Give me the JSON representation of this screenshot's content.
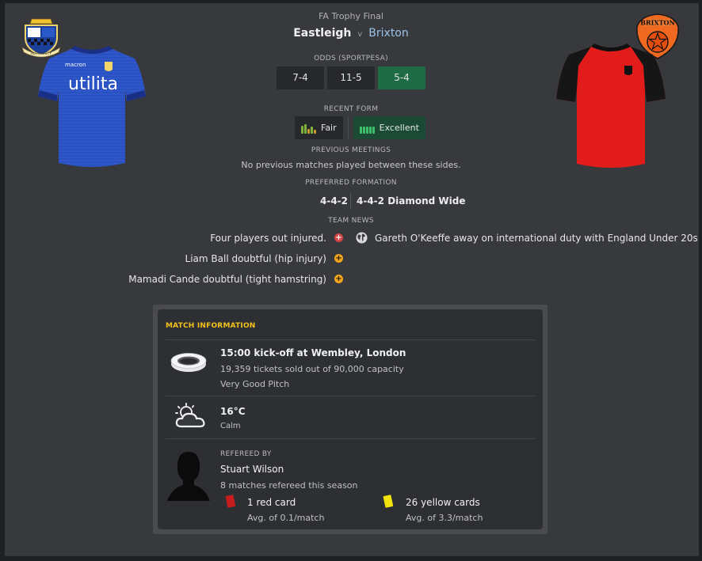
{
  "header": {
    "competition": "FA Trophy Final",
    "home_team": "Eastleigh",
    "vs": "v",
    "away_team": "Brixton"
  },
  "crests": {
    "home_motto": "AUTHORITY",
    "away_name": "BRIXTON"
  },
  "kits": {
    "home_sponsor": "utilita",
    "home_brand": "macron"
  },
  "odds": {
    "label": "ODDS (SPORTPESA)",
    "values": [
      "7-4",
      "11-5",
      "5-4"
    ],
    "highlight_color": "#1e6b45"
  },
  "recent_form": {
    "label": "RECENT FORM",
    "home": "Fair",
    "away": "Excellent"
  },
  "previous_meetings": {
    "label": "PREVIOUS MEETINGS",
    "text": "No previous matches played between these sides."
  },
  "preferred_formation": {
    "label": "PREFERRED FORMATION",
    "home": "4-4-2",
    "away": "4-4-2 Diamond Wide"
  },
  "team_news": {
    "label": "TEAM NEWS",
    "home": [
      {
        "text": "Four players out injured.",
        "icon": "injury-icon"
      },
      {
        "text": "Liam Ball doubtful (hip injury)",
        "icon": "doubtful-icon"
      },
      {
        "text": "Mamadi Cande doubtful (tight hamstring)",
        "icon": "doubtful-icon"
      }
    ],
    "away": [
      {
        "text": "Gareth O'Keeffe away on international duty with England Under 20s",
        "icon": "globe-icon"
      }
    ]
  },
  "match_info": {
    "title": "MATCH INFORMATION",
    "venue": {
      "kickoff": "15:00 kick-off at Wembley, London",
      "tickets": "19,359 tickets sold out of 90,000 capacity",
      "pitch": "Very Good Pitch"
    },
    "weather": {
      "temperature": "16°C",
      "wind": "Calm"
    },
    "referee": {
      "label": "REFEREED BY",
      "name": "Stuart Wilson",
      "matches": "8 matches refereed this season",
      "red_cards": "1 red card",
      "red_avg": "Avg. of 0.1/match",
      "yellow_cards": "26 yellow cards",
      "yellow_avg": "Avg. of 3.3/match"
    }
  },
  "colors": {
    "accent_gold": "#f3c21b",
    "away_link": "#9cc3ea",
    "injury_red": "#d64545",
    "doubt_amber": "#f0a51c"
  }
}
